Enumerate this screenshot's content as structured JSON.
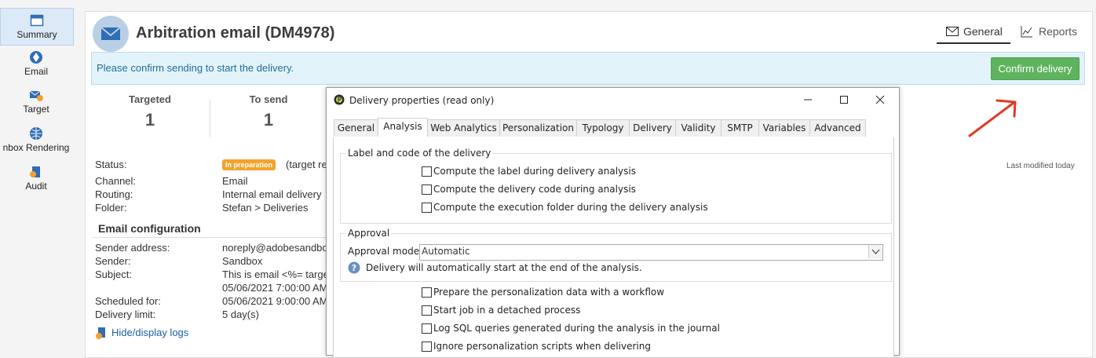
{
  "nav": {
    "items": [
      {
        "label": "Summary",
        "icon": "summary-icon",
        "active": true
      },
      {
        "label": "Email",
        "icon": "email-icon"
      },
      {
        "label": "Target",
        "icon": "target-icon"
      },
      {
        "label": "nbox Rendering",
        "icon": "inbox-rendering-icon"
      },
      {
        "label": "Audit",
        "icon": "audit-icon"
      }
    ]
  },
  "header": {
    "title": "Arbitration email (DM4978)",
    "tabs": [
      {
        "label": "General",
        "icon": "envelope-icon"
      },
      {
        "label": "Reports",
        "icon": "chart-icon"
      }
    ]
  },
  "banner": {
    "text": "Please confirm sending to start the delivery.",
    "button": "Confirm delivery"
  },
  "stats": [
    {
      "label": "Targeted",
      "value": "1"
    },
    {
      "label": "To send",
      "value": "1"
    }
  ],
  "details": {
    "status_label": "Status:",
    "status_badge": "In preparation",
    "status_note": "(target re",
    "channel_label": "Channel:",
    "channel": "Email",
    "routing_label": "Routing:",
    "routing": "Internal email delivery",
    "folder_label": "Folder:",
    "folder": "Stefan > Deliveries",
    "last_modified": "Last modified today"
  },
  "email_config": {
    "title": "Email configuration",
    "sender_address_label": "Sender address:",
    "sender_address": "noreply@adobesandbo",
    "sender_label": "Sender:",
    "sender": "Sandbox",
    "subject_label": "Subject:",
    "subject": "This is email <%= targe",
    "subject_date": "05/06/2021 7:00:00 AM",
    "scheduled_label": "Scheduled for:",
    "scheduled": "05/06/2021 9:00:00 AM",
    "limit_label": "Delivery limit:",
    "limit": "5 day(s)",
    "logs_link": "Hide/display logs"
  },
  "dialog": {
    "title": "Delivery properties (read only)",
    "tabs": [
      "General",
      "Analysis",
      "Web Analytics",
      "Personalization",
      "Typology",
      "Delivery",
      "Validity",
      "SMTP",
      "Variables",
      "Advanced"
    ],
    "active_tab": "Analysis",
    "group1": {
      "label": "Label and code of the delivery",
      "options": [
        "Compute the label during delivery analysis",
        "Compute the delivery code during analysis",
        "Compute the execution folder during the delivery analysis"
      ]
    },
    "group2": {
      "label": "Approval",
      "mode_label": "Approval mode:",
      "mode_value": "Automatic",
      "info": "Delivery will automatically start at the end of the analysis."
    },
    "options": [
      "Prepare the personalization data with a workflow",
      "Start job in a detached process",
      "Log SQL queries generated during the analysis in the journal",
      "Ignore personalization scripts when delivering"
    ]
  },
  "colors": {
    "accent": "#5fb35e",
    "banner_bg": "#e3f3fa",
    "badge": "#f4a22c",
    "annotation": "#e03a25"
  }
}
